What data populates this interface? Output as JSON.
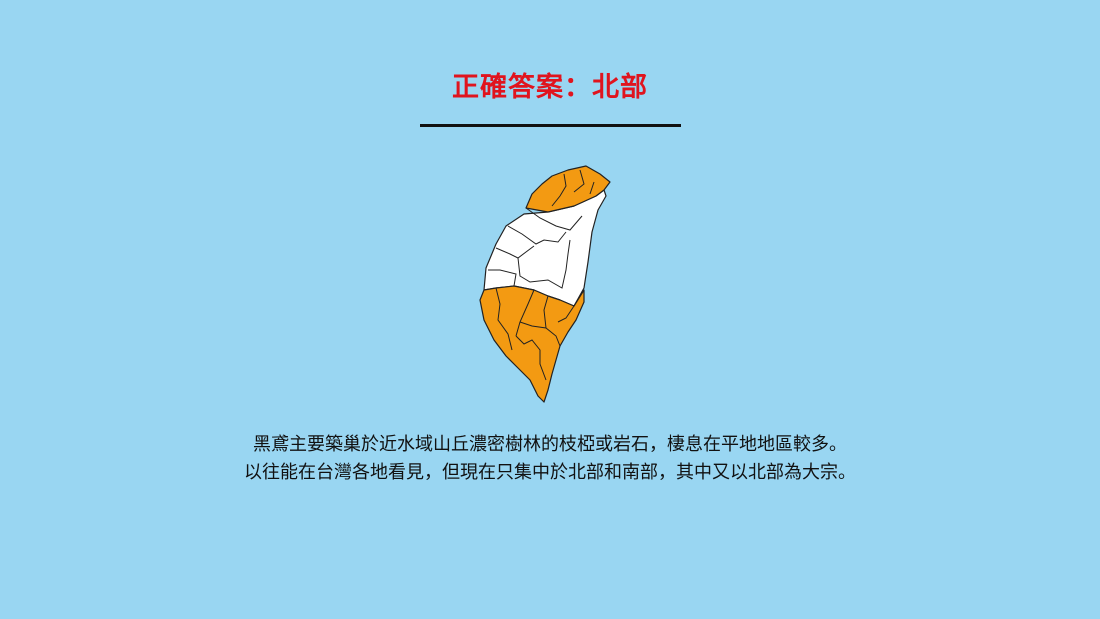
{
  "slide": {
    "title": "正確答案：北部",
    "title_color": "#e0141e",
    "background_color": "#99d6f2",
    "map": {
      "icon": "taiwan-map-icon",
      "highlight_color": "#f39a12",
      "base_color": "#ffffff",
      "highlighted_regions": [
        "north",
        "south"
      ]
    },
    "body": {
      "line1": "黑鳶主要築巢於近水域山丘濃密樹林的枝椏或岩石，棲息在平地地區較多。",
      "line2": "以往能在台灣各地看見，但現在只集中於北部和南部，其中又以北部為大宗。"
    }
  }
}
